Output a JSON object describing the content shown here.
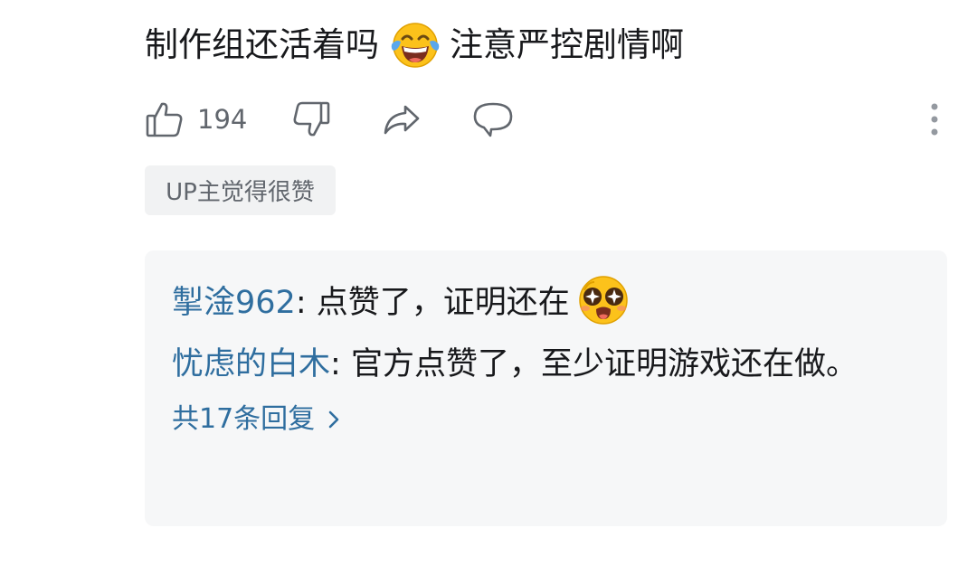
{
  "comment": {
    "text_before": "制作组还活着吗",
    "emoji_1": "laughing-tears-emoji",
    "text_after": "注意严控剧情啊"
  },
  "actions": {
    "like_icon": "thumbs-up-icon",
    "like_count": "194",
    "dislike_icon": "thumbs-down-icon",
    "share_icon": "share-icon",
    "reply_icon": "comment-bubble-icon",
    "more_icon": "more-vertical-icon"
  },
  "badge": "UP主觉得很赞",
  "replies": {
    "items": [
      {
        "user": "掣淦962",
        "sep": ": ",
        "text": "点赞了，证明还在",
        "emoji": "starry-eyed-emoji"
      },
      {
        "user": "忧虑的白木",
        "sep": ": ",
        "text": "官方点赞了，至少证明游戏还在做。"
      }
    ],
    "more_label": "共17条回复",
    "more_icon": "chevron-right-icon"
  },
  "colors": {
    "link_blue": "#2f6e9f",
    "icon_gray": "#61666d",
    "text": "#18191c",
    "reply_bg": "#f6f7f8",
    "badge_bg": "#f1f2f3"
  }
}
